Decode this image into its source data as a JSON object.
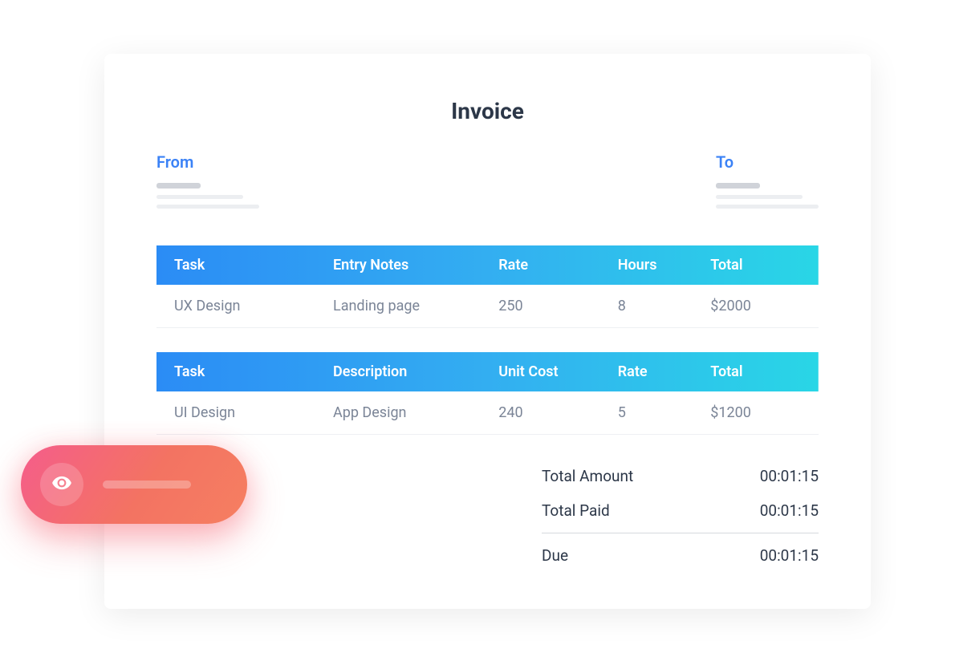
{
  "title": "Invoice",
  "from": {
    "label": "From"
  },
  "to": {
    "label": "To"
  },
  "table1": {
    "headers": {
      "task": "Task",
      "notes": "Entry Notes",
      "rate": "Rate",
      "hours": "Hours",
      "total": "Total"
    },
    "rows": [
      {
        "task": "UX Design",
        "notes": "Landing page",
        "rate": "250",
        "hours": "8",
        "total": "$2000"
      }
    ]
  },
  "table2": {
    "headers": {
      "task": "Task",
      "description": "Description",
      "unit_cost": "Unit Cost",
      "rate": "Rate",
      "total": "Total"
    },
    "rows": [
      {
        "task": "UI Design",
        "description": "App Design",
        "unit_cost": "240",
        "rate": "5",
        "total": "$1200"
      }
    ]
  },
  "summary": {
    "total_amount": {
      "label": "Total Amount",
      "value": "00:01:15"
    },
    "total_paid": {
      "label": "Total Paid",
      "value": "00:01:15"
    },
    "due": {
      "label": "Due",
      "value": "00:01:15"
    }
  }
}
